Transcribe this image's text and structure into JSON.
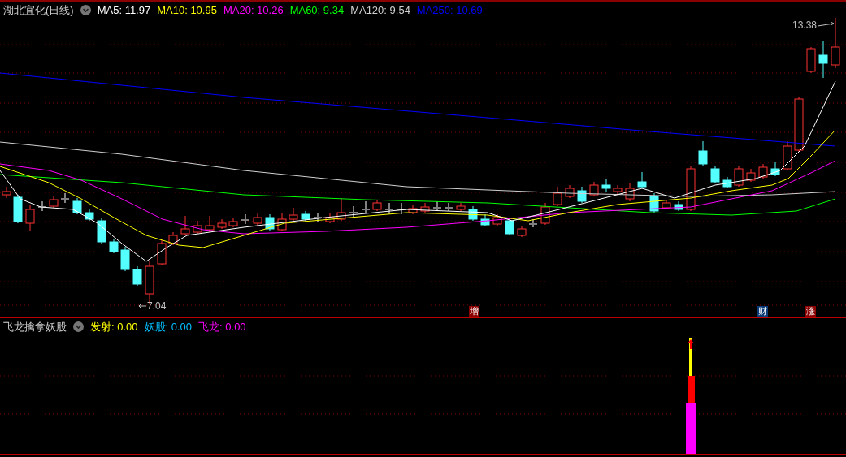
{
  "main_panel": {
    "title": "湖北宜化(日线)",
    "indicators": [
      {
        "label": "MA5: 11.97",
        "color": "#ffffff"
      },
      {
        "label": "MA10: 10.95",
        "color": "#ffff00"
      },
      {
        "label": "MA20: 10.26",
        "color": "#ff00ff"
      },
      {
        "label": "MA60: 9.34",
        "color": "#00ff00"
      },
      {
        "label": "MA120: 9.54",
        "color": "#d0d0d0"
      },
      {
        "label": "MA250: 10.69",
        "color": "#0000ff"
      }
    ],
    "price_labels": [
      {
        "kind": "high",
        "text": "13.38"
      },
      {
        "kind": "low",
        "text": "7.04"
      }
    ],
    "markers": [
      {
        "text": "增",
        "color": "#8b0000"
      },
      {
        "text": "财",
        "color": "#0a3a78"
      },
      {
        "text": "涨",
        "color": "#8b0000"
      }
    ]
  },
  "sub_panel": {
    "title": "飞龙擒拿妖股",
    "indicators": [
      {
        "label": "发射: 0.00",
        "color": "#ffff00"
      },
      {
        "label": "妖股: 0.00",
        "color": "#00bfff"
      },
      {
        "label": "飞龙: 0.00",
        "color": "#ff00ff"
      }
    ]
  }
}
